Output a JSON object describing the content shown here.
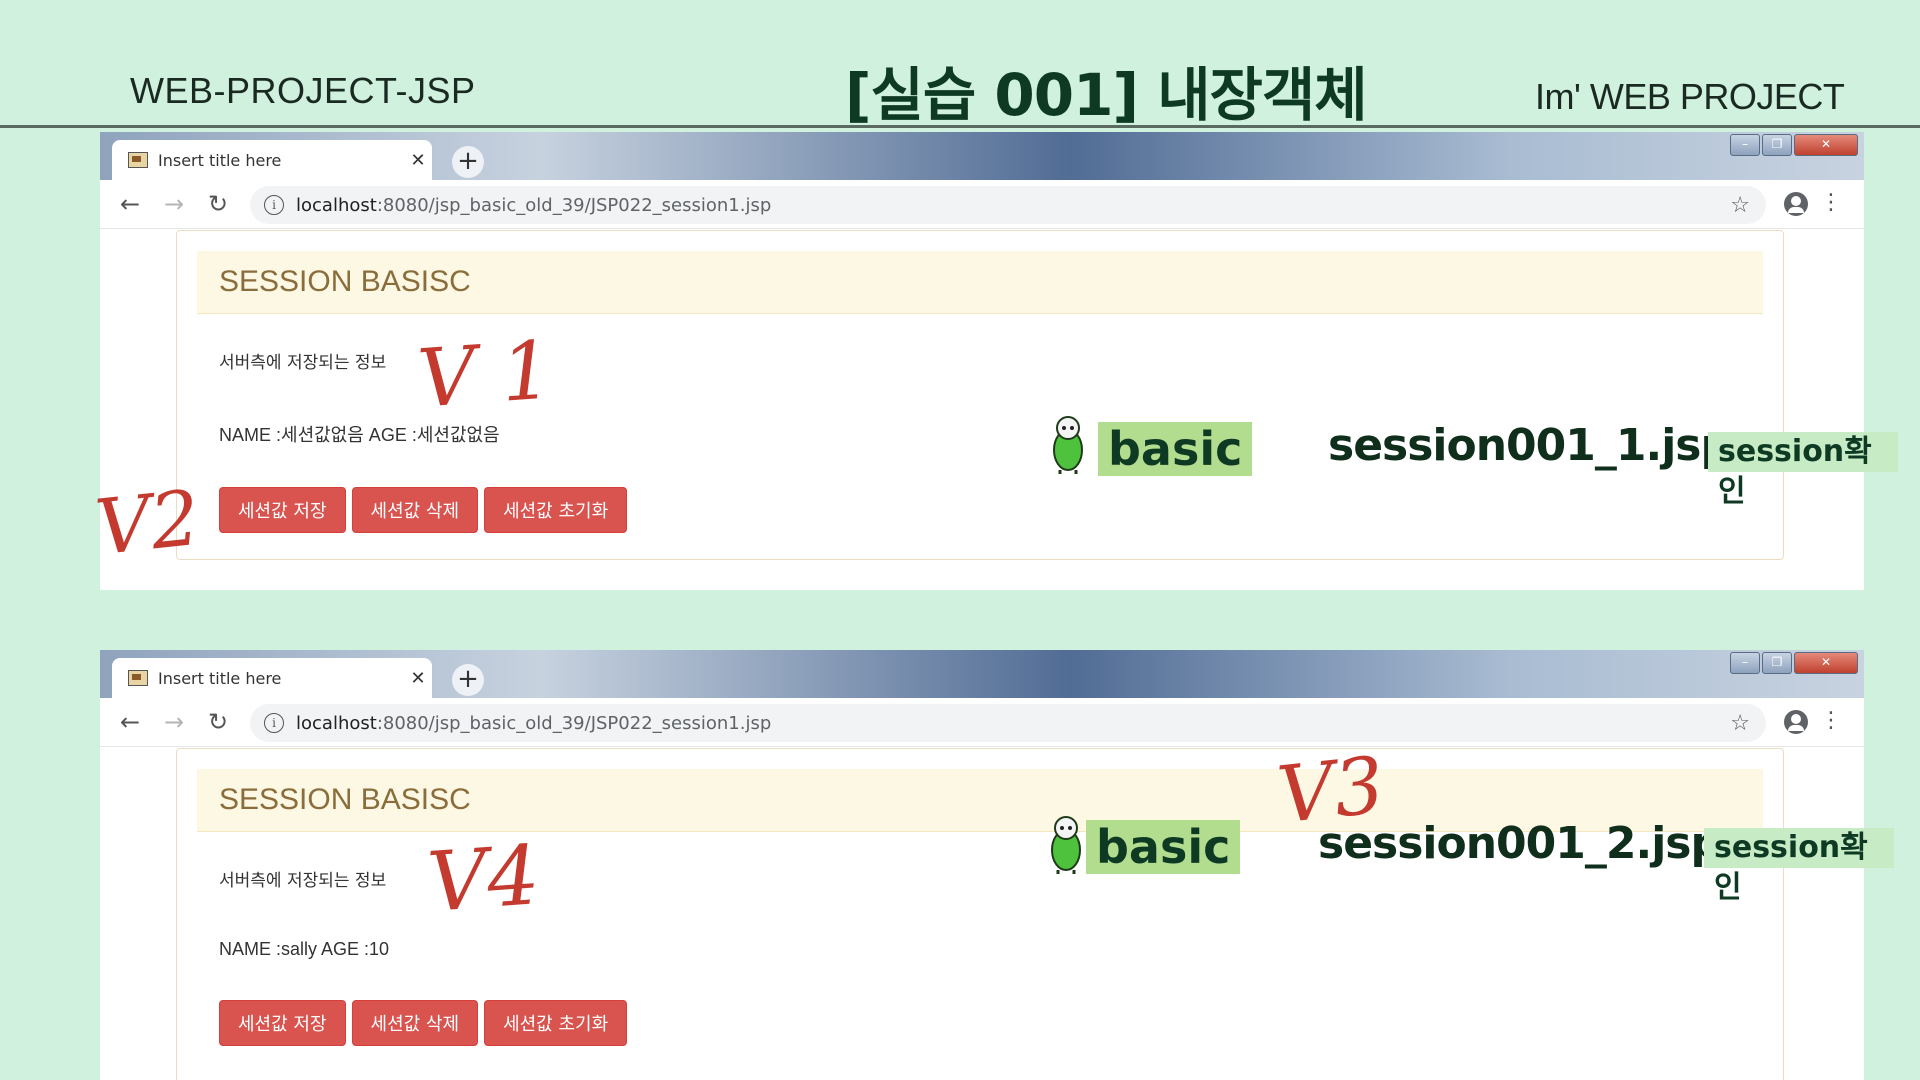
{
  "slide": {
    "left_title": "WEB-PROJECT-JSP",
    "center_title": "[실습 001]  내장객체",
    "right_title": "Im'  WEB PROJECT"
  },
  "browsers": [
    {
      "tab_title": "Insert title here",
      "url_host": "localhost",
      "url_path": ":8080/jsp_basic_old_39/JSP022_session1.jsp",
      "panel_heading": "SESSION BASISC",
      "info_text": "서버측에 저장되는 정보",
      "name_line": "NAME :세션값없음 AGE :세션값없음",
      "buttons": [
        "세션값 저장",
        "세션값 삭제",
        "세션값 초기화"
      ]
    },
    {
      "tab_title": "Insert title here",
      "url_host": "localhost",
      "url_path": ":8080/jsp_basic_old_39/JSP022_session1.jsp",
      "panel_heading": "SESSION BASISC",
      "info_text": "서버측에 저장되는 정보",
      "name_line": "NAME :sally AGE :10",
      "buttons": [
        "세션값 저장",
        "세션값 삭제",
        "세션값 초기화"
      ]
    }
  ],
  "annotations": [
    {
      "basic": "basic",
      "file": "session001_1.jsp",
      "check": "session확인"
    },
    {
      "basic": "basic",
      "file": "session001_2.jsp",
      "check": "session확인"
    }
  ],
  "marks": [
    "V 1",
    "V2",
    "V3",
    "V4"
  ],
  "colors": {
    "background": "#d0f1de",
    "button": "#d9534f",
    "panel_heading_bg": "#fcf8e3",
    "basic_label_bg": "#b2dd8f",
    "mark_red": "#c43a2f"
  }
}
